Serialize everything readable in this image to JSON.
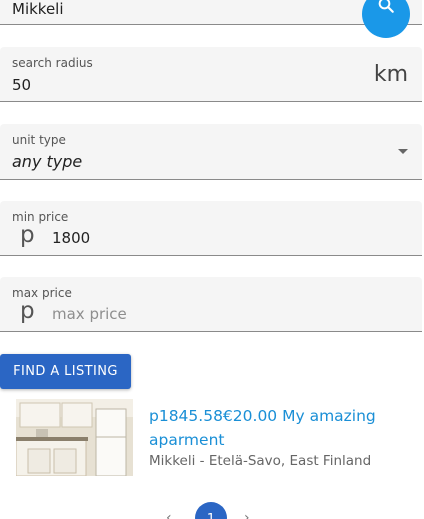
{
  "location": {
    "value": "Mikkeli",
    "search_icon": "search-icon"
  },
  "radius": {
    "label": "search radius",
    "value": "50",
    "unit": "km"
  },
  "unit_type": {
    "label": "unit type",
    "value": "any type",
    "icon": "chevron-down-icon"
  },
  "min_price": {
    "label": "min price",
    "prefix": "p",
    "value": "1800"
  },
  "max_price": {
    "label": "max price",
    "prefix": "p",
    "placeholder": "max price"
  },
  "find_button": "FIND A LISTING",
  "listings": [
    {
      "title": "p1845.58€20.00 My amazing aparment",
      "location": "Mikkeli - Etelä-Savo, East Finland"
    }
  ],
  "pagination": {
    "current": "1",
    "prev_icon": "chevron-left-icon",
    "next_icon": "chevron-right-icon"
  },
  "colors": {
    "accent": "#2b66c4",
    "search_button": "#1a98e8",
    "link": "#1a8fd6"
  }
}
